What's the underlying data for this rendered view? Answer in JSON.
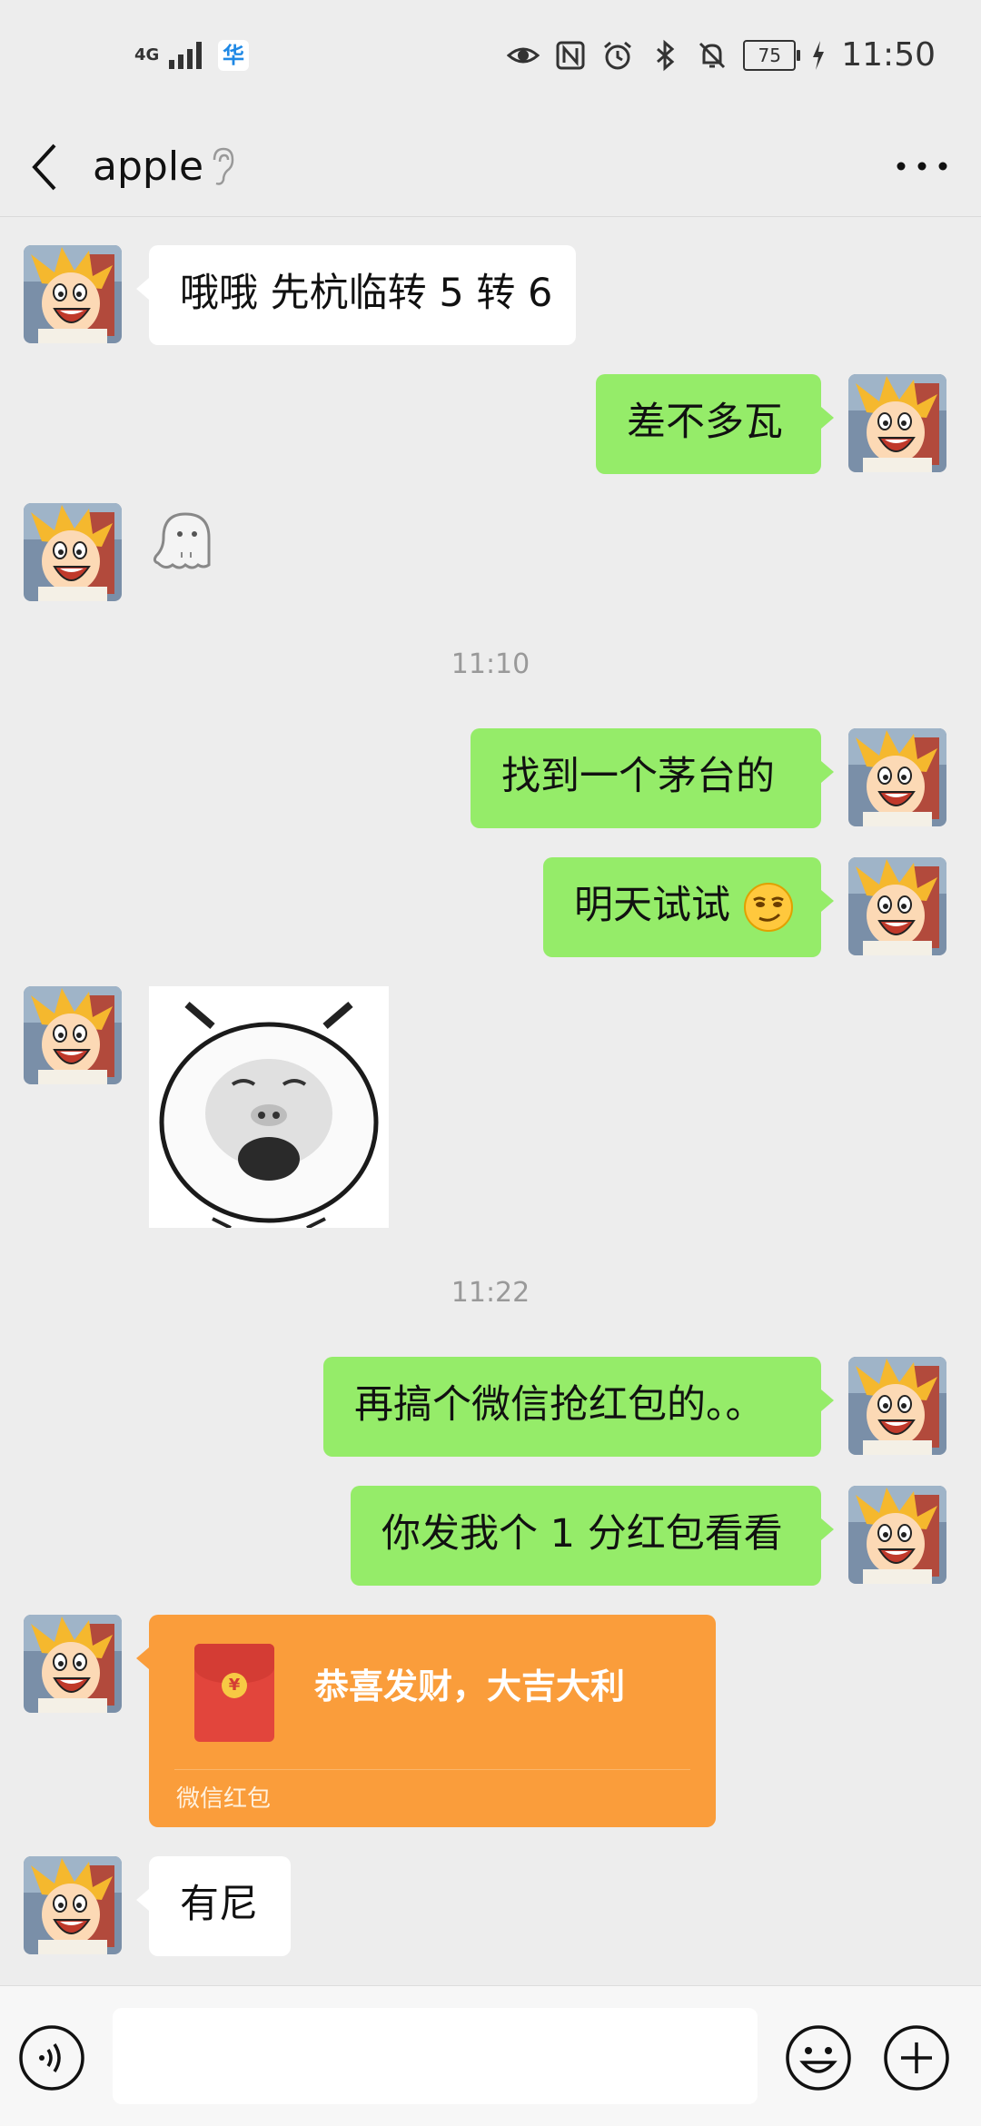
{
  "status_bar": {
    "network": "4G",
    "time": "11:50",
    "battery": "75",
    "app_badge": "华"
  },
  "nav": {
    "title": "apple"
  },
  "messages": [
    {
      "from": "other",
      "type": "text",
      "text": "哦哦 先杭临转 5 转 6"
    },
    {
      "from": "me",
      "type": "text",
      "text": "差不多瓦"
    },
    {
      "from": "other",
      "type": "sticker",
      "sticker": "ghost-emoji"
    },
    {
      "type": "time",
      "text": "11:10"
    },
    {
      "from": "me",
      "type": "text",
      "text": "找到一个茅台的"
    },
    {
      "from": "me",
      "type": "text",
      "text": "明天试试",
      "emoji": "smirk-face-emoji"
    },
    {
      "from": "other",
      "type": "sticker",
      "sticker": "pig-face-meme"
    },
    {
      "type": "time",
      "text": "11:22"
    },
    {
      "from": "me",
      "type": "text",
      "text": "再搞个微信抢红包的。。"
    },
    {
      "from": "me",
      "type": "text",
      "text": "你发我个 1 分红包看看"
    },
    {
      "from": "other",
      "type": "red_packet",
      "greeting": "恭喜发财，大吉大利",
      "label": "微信红包"
    },
    {
      "from": "other",
      "type": "text",
      "text": "有尼"
    }
  ],
  "input": {
    "placeholder": ""
  },
  "colors": {
    "background": "#EDEDED",
    "outgoing_bubble": "#95EC69",
    "incoming_bubble": "#FFFFFF",
    "red_packet": "#FA9D3B"
  }
}
